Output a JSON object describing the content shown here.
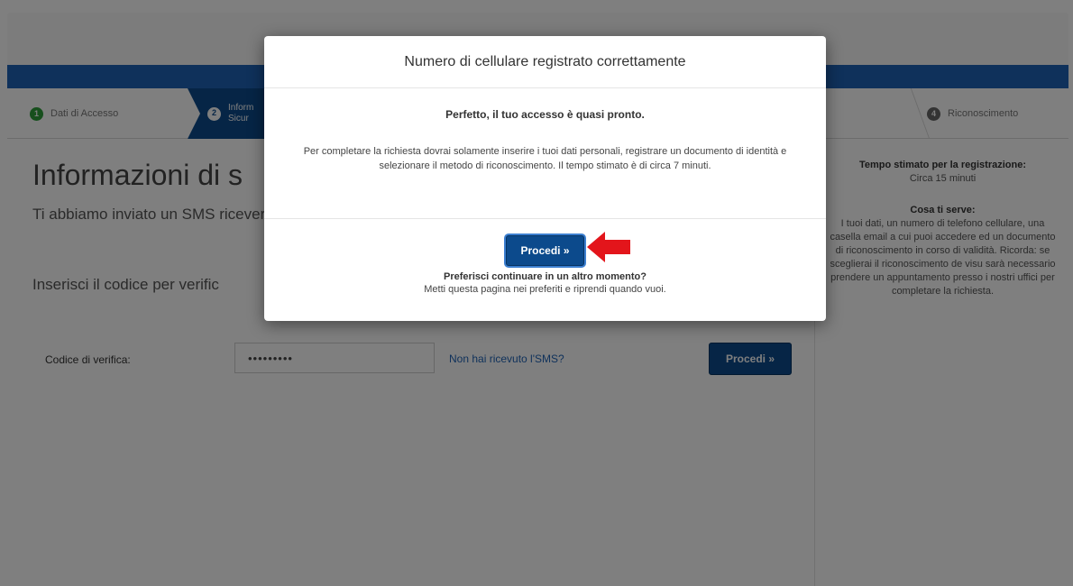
{
  "steps": {
    "step1": {
      "number": "1",
      "label": "Dati di Accesso"
    },
    "step2": {
      "number": "2",
      "label_line1": "Inform",
      "label_line2": "Sicur"
    },
    "step_last": {
      "number": "4",
      "label": "Riconoscimento"
    }
  },
  "main": {
    "title": "Informazioni di s",
    "intro": "Ti abbiamo inviato un SMS riceverlo tra pochi istanti.",
    "prompt": "Inserisci il codice per verific",
    "code_label": "Codice di verifica:",
    "code_value": "•••••••••",
    "sms_link": "Non hai ricevuto l'SMS?",
    "proceed_label": "Procedi »"
  },
  "sidebar": {
    "time_heading": "Tempo stimato per la registrazione:",
    "time_value": "Circa 15 minuti",
    "needs_heading": "Cosa ti serve:",
    "needs_text": "I tuoi dati, un numero di telefono cellulare, una casella email a cui puoi accedere ed un documento di riconoscimento in corso di validità. Ricorda: se sceglierai il riconoscimento de visu sarà necessario prendere un appuntamento presso i nostri uffici per completare la richiesta."
  },
  "modal": {
    "title": "Numero di cellulare registrato correttamente",
    "lead": "Perfetto, il tuo accesso è quasi pronto.",
    "text": "Per completare la richiesta dovrai solamente inserire i tuoi dati personali, registrare un documento di identità e selezionare il metodo di riconoscimento. Il tempo stimato è di circa 7 minuti.",
    "proceed_label": "Procedi »",
    "later_question": "Preferisci continuare in un altro momento?",
    "later_text": "Metti questa pagina nei preferiti e riprendi quando vuoi."
  },
  "colors": {
    "brand_blue": "#0c4a8c",
    "header_blue": "#1f63b6",
    "step_done": "#2e9e3b",
    "arrow_red": "#e3151b"
  }
}
